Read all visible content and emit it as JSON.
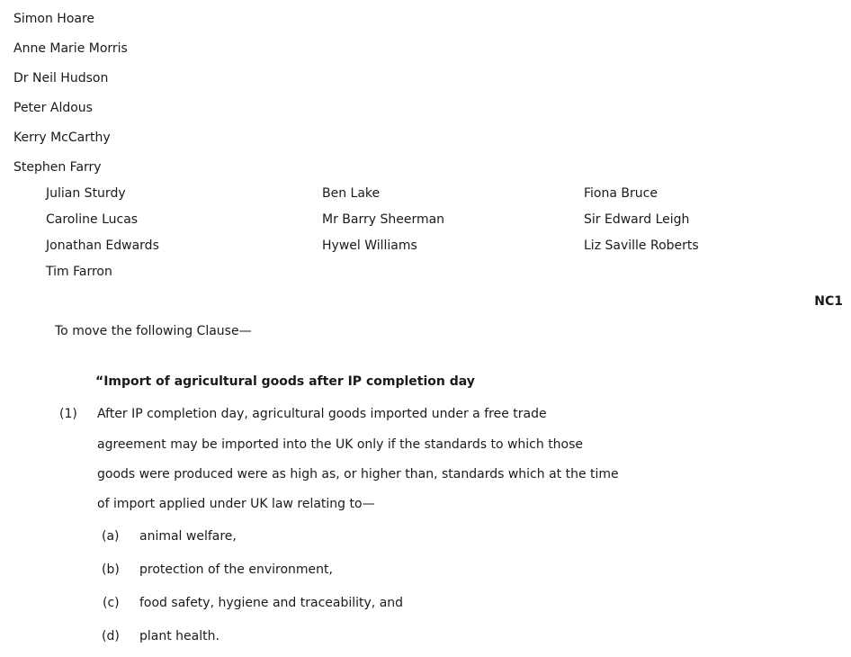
{
  "primary_sponsors": [
    "Simon Hoare",
    "Anne Marie Morris",
    "Dr Neil Hudson",
    "Peter Aldous",
    "Kerry McCarthy",
    "Stephen Farry"
  ],
  "supporters": {
    "col1": [
      "Julian Sturdy",
      "Caroline Lucas",
      "Jonathan Edwards",
      "Tim Farron"
    ],
    "col2": [
      "Ben Lake",
      "Mr Barry Sheerman",
      "Hywel Williams"
    ],
    "col3": [
      "Fiona Bruce",
      "Sir Edward Leigh",
      "Liz Saville Roberts"
    ]
  },
  "amendment_number": "NC1",
  "intro": "To move the following Clause—",
  "clause_title": "“Import of agricultural goods after IP completion day",
  "subsection": {
    "number": "(1)",
    "lines": [
      "After IP completion day, agricultural goods imported under a free trade",
      "agreement may be imported into the UK only if the standards to which those",
      "goods were produced were as high as, or higher than, standards which at the time",
      "of import applied under UK law relating to—"
    ]
  },
  "paragraphs": [
    {
      "label": "(a)",
      "text": "animal welfare,"
    },
    {
      "label": "(b)",
      "text": "protection of the environment,"
    },
    {
      "label": "(c)",
      "text": "food safety, hygiene and traceability, and"
    },
    {
      "label": "(d)",
      "text": "plant health."
    }
  ]
}
